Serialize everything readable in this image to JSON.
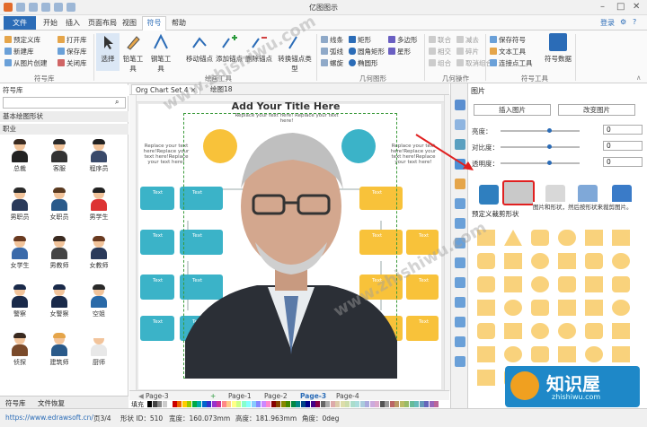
{
  "window": {
    "title": "亿图图示"
  },
  "tabs": [
    "文件",
    "开始",
    "插入",
    "页面布局",
    "视图",
    "符号",
    "帮助"
  ],
  "top_right": {
    "login": "登录"
  },
  "ribbon": {
    "col1": [
      "预定义库",
      "新建库",
      "从图片创建"
    ],
    "col2": [
      "打开库",
      "保存库",
      "关闭库"
    ],
    "group1": "符号库",
    "big_buttons": [
      "选择",
      "铅笔工具",
      "钢笔工具"
    ],
    "edit_tools": [
      "移动锚点",
      "添加锚点",
      "删除锚点",
      "转换锚点类型"
    ],
    "group2": "绘画工具",
    "geo_col1": [
      "线条",
      "弧线",
      "螺旋"
    ],
    "geo_col2": [
      "矩形",
      "圆角矩形",
      "椭圆形"
    ],
    "geo_col3": [
      "多边形",
      "星形"
    ],
    "group3": "几何图形",
    "ops_col1": [
      "联合",
      "相交",
      "组合"
    ],
    "ops_col2": [
      "减去",
      "碎片",
      "取消组合"
    ],
    "group4": "几何操作",
    "sym_tools": [
      "保存符号",
      "文本工具",
      "连接点工具"
    ],
    "sym_data": "符号数据",
    "group5": "符号工具"
  },
  "left_panel": {
    "title": "符号库",
    "search_placeholder": "",
    "cat1": "基本绘图形状",
    "cat2": "职业",
    "symbols": [
      "总裁",
      "客服",
      "程序员",
      "男职员",
      "女职员",
      "男学生",
      "女学生",
      "男教师",
      "女教师",
      "警察",
      "女警察",
      "空姐",
      "侦探",
      "建筑师",
      "厨师"
    ],
    "bottom_tabs": [
      "符号库",
      "文件恢复"
    ]
  },
  "doc_tabs": [
    "Org Chart Set 4",
    "绘图18"
  ],
  "canvas": {
    "title": "Add Your Title Here",
    "subtitle": "Replace your text here!  Replace your text here!",
    "side_text": "Replace your text here!Replace your text here!Replace your text here!",
    "node_label": "Text"
  },
  "page_tabs": [
    "Page-3",
    "Page-1",
    "Page-2",
    "Page-3",
    "Page-4"
  ],
  "palette_label": "填充",
  "right_panel": {
    "title": "图片",
    "insert_btn": "插入图片",
    "change_btn": "改变图片",
    "brightness": "亮度：",
    "contrast": "对比度：",
    "transparency": "透明度：",
    "values": [
      "0",
      "0",
      "0"
    ],
    "tooltip": "图片和形状，然后按形状来裁剪图片。",
    "preset_label": "预定义裁剪形状"
  },
  "status": {
    "url": "https://www.edrawsoft.cn/",
    "page": "页3/4",
    "shape_id": "形状 ID：510",
    "width": "宽度：160.073mm",
    "height": "高度：181.963mm",
    "angle": "角度：0deg"
  },
  "watermark": {
    "site": "www.zhishiwu.com",
    "brand": "知识屋",
    "sub": "zhishiwu.com"
  },
  "colors": {
    "accent": "#2b6cb7",
    "node_teal": "#3bb3c8",
    "node_yellow": "#f8c23a",
    "shape_fill": "#f9d27c",
    "highlight": "#e02020"
  }
}
